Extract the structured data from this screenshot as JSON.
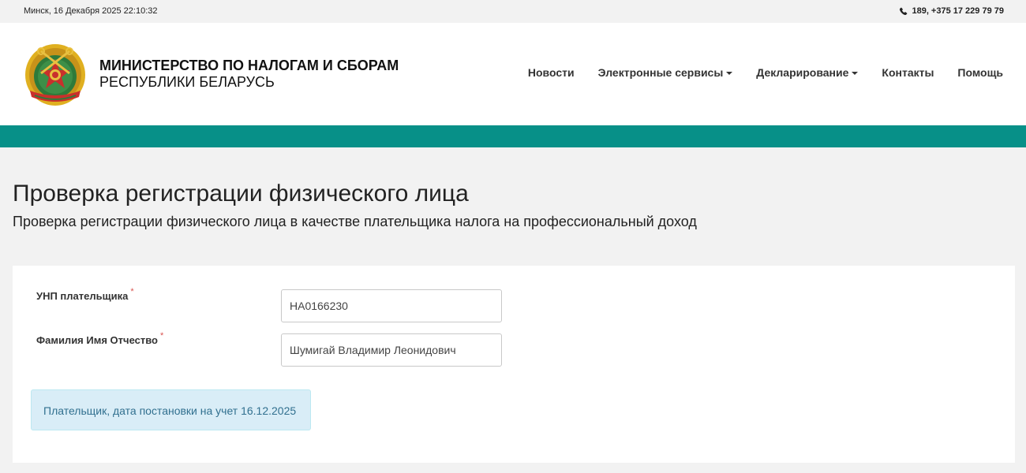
{
  "topbar": {
    "datetime": "Минск, 16 Декабря 2025 22:10:32",
    "phone": "189, +375 17 229 79 79"
  },
  "header": {
    "brand_line1": "МИНИСТЕРСТВО ПО НАЛОГАМ И СБОРАМ",
    "brand_line2": "РЕСПУБЛИКИ БЕЛАРУСЬ",
    "logo": "ministry-emblem",
    "nav": [
      {
        "label": "Новости",
        "dropdown": false
      },
      {
        "label": "Электронные сервисы",
        "dropdown": true
      },
      {
        "label": "Декларирование",
        "dropdown": true
      },
      {
        "label": "Контакты",
        "dropdown": false
      },
      {
        "label": "Помощь",
        "dropdown": false
      }
    ]
  },
  "colors": {
    "accent_band": "#079088",
    "alert_bg": "#d9edf7",
    "alert_text": "#31708f",
    "required_star": "#d9534f"
  },
  "page": {
    "title": "Проверка регистрации физического лица",
    "subtitle": "Проверка регистрации физического лица в качестве плательщика налога на профессиональный доход"
  },
  "form": {
    "unp_label": "УНП плательщика",
    "unp_value": "НА0166230",
    "fio_label": "Фамилия Имя Отчество",
    "fio_value": "Шумигай Владимир Леонидович",
    "required_mark": "*"
  },
  "result": {
    "message": "Плательщик, дата постановки на учет 16.12.2025"
  }
}
